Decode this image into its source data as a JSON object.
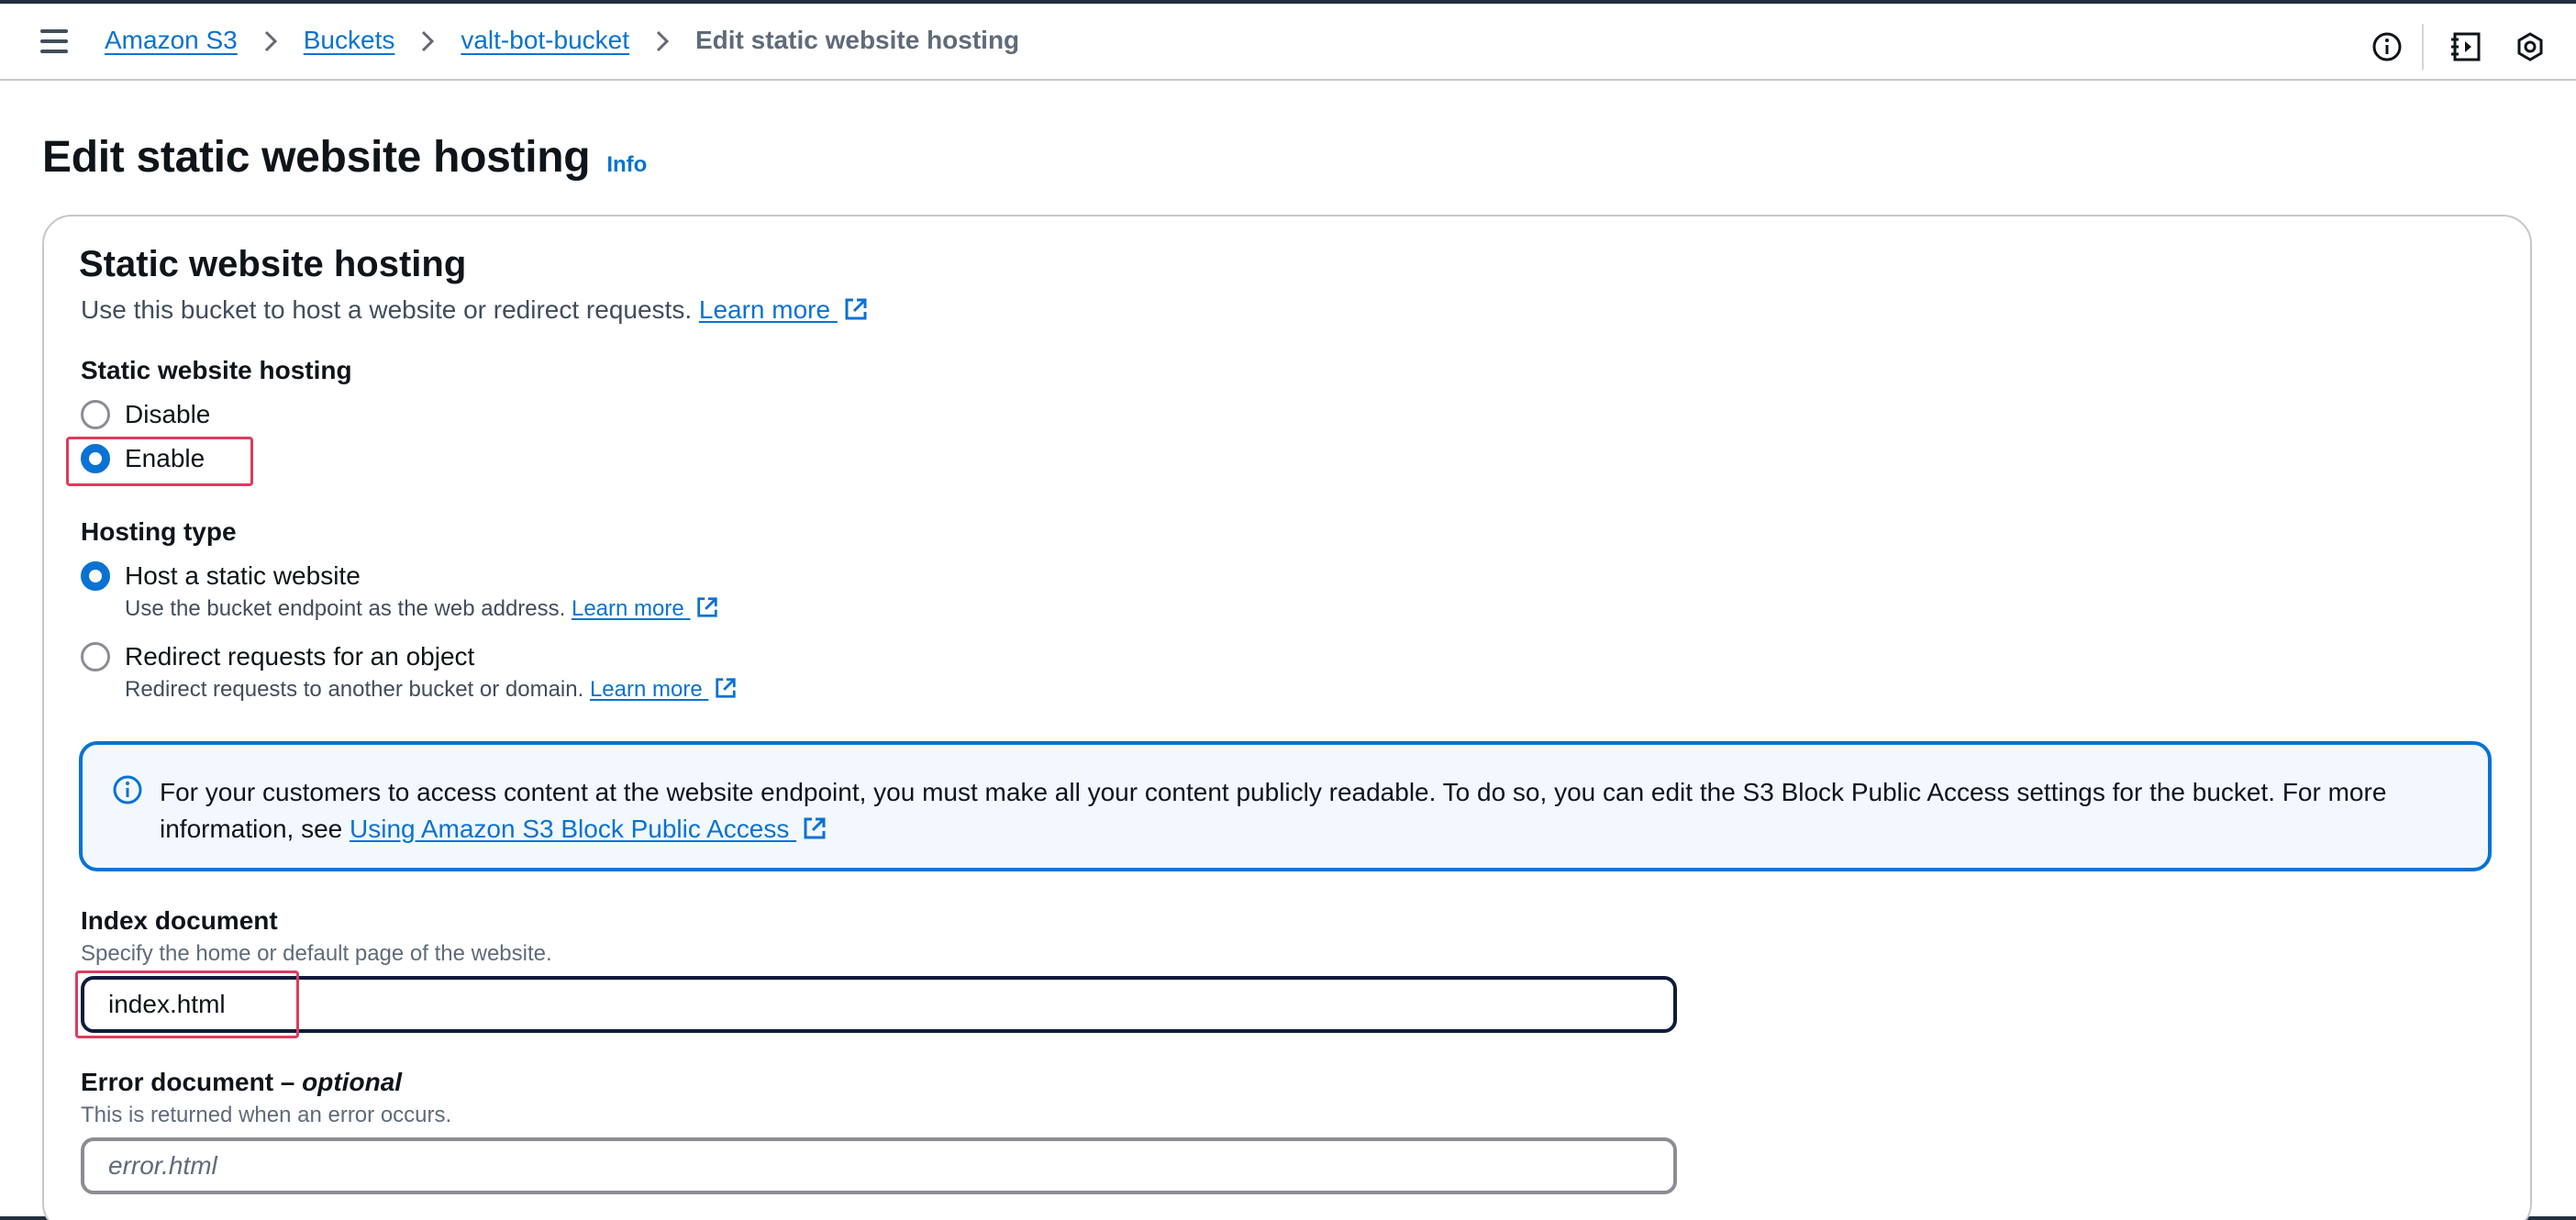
{
  "breadcrumb": {
    "items": [
      "Amazon S3",
      "Buckets",
      "valt-bot-bucket"
    ],
    "current": "Edit static website hosting"
  },
  "header": {
    "title": "Edit static website hosting",
    "info_label": "Info"
  },
  "section": {
    "title": "Static website hosting",
    "description": "Use this bucket to host a website or redirect requests.",
    "learn_more": "Learn more"
  },
  "hosting": {
    "label": "Static website hosting",
    "options": [
      "Disable",
      "Enable"
    ],
    "selected": "Enable"
  },
  "hosting_type": {
    "label": "Hosting type",
    "options": [
      {
        "label": "Host a static website",
        "description": "Use the bucket endpoint as the web address.",
        "learn_more": "Learn more"
      },
      {
        "label": "Redirect requests for an object",
        "description": "Redirect requests to another bucket or domain.",
        "learn_more": "Learn more"
      }
    ],
    "selected": "Host a static website"
  },
  "alert": {
    "text": "For your customers to access content at the website endpoint, you must make all your content publicly readable. To do so, you can edit the S3 Block Public Access settings for the bucket. For more information, see ",
    "link": "Using Amazon S3 Block Public Access"
  },
  "index_document": {
    "label": "Index document",
    "description": "Specify the home or default page of the website.",
    "value": "index.html"
  },
  "error_document": {
    "label": "Error document",
    "optional": "optional",
    "description": "This is returned when an error occurs.",
    "placeholder": "error.html"
  },
  "icons": {
    "menu": "hamburger-menu-icon",
    "info": "info-circle-icon",
    "panel": "side-panel-icon",
    "settings": "hexagon-settings-icon",
    "external": "external-link-icon"
  },
  "colors": {
    "link": "#0972d3",
    "highlight": "#e03a5c",
    "alert_bg": "#f2f8fd",
    "header_bar": "#232f3e"
  }
}
